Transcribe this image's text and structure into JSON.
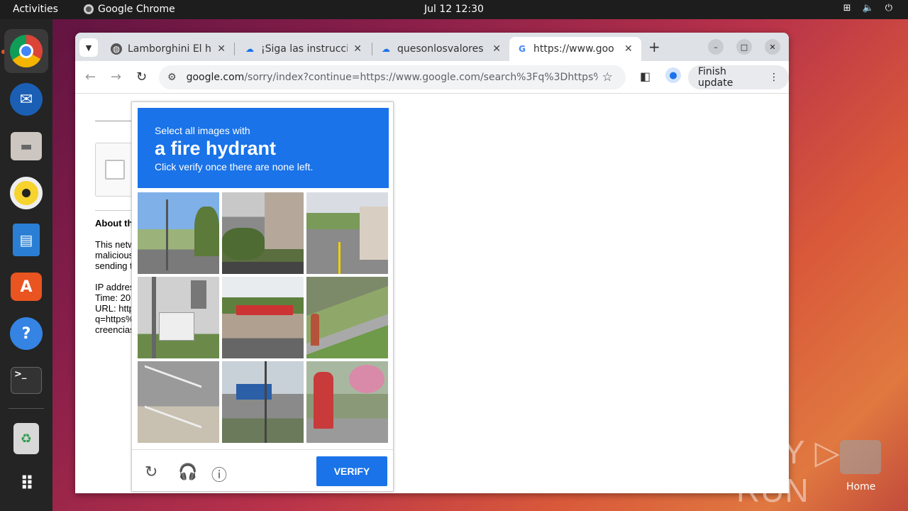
{
  "topbar": {
    "activities": "Activities",
    "app_name": "Google Chrome",
    "clock": "Jul 12  12:30"
  },
  "dock": {
    "items": [
      "chrome-icon",
      "thunderbird-icon",
      "files-icon",
      "rhythmbox-icon",
      "writer-icon",
      "app-center-icon",
      "help-icon",
      "terminal-icon",
      "trash-icon",
      "app-grid-icon"
    ]
  },
  "browser": {
    "tabs": [
      {
        "title": "Lamborghini El he",
        "active": false
      },
      {
        "title": "¡Siga las instrucci",
        "active": false
      },
      {
        "title": "quesonlosvalores",
        "active": false
      },
      {
        "title": "https://www.goo",
        "active": true
      }
    ],
    "url_host": "google.com",
    "url_path": "/sorry/index?continue=https://www.google.com/search%3Fq%3Dhttps%253A...",
    "finish_update": "Finish update"
  },
  "page": {
    "about_heading": "About th",
    "para1": [
      "This netw",
      "malicious",
      "sending t"
    ],
    "para2": [
      "IP addres",
      "Time: 20",
      "URL: http",
      "q=https%",
      "creencias"
    ]
  },
  "captcha": {
    "line1": "Select all images with",
    "line2": "a fire hydrant",
    "line3": "Click verify once there are none left.",
    "verify_label": "VERIFY",
    "accent": "#1a73e8"
  },
  "watermark": {
    "text": "ANY ▷ RUN",
    "home_label": "Home"
  }
}
